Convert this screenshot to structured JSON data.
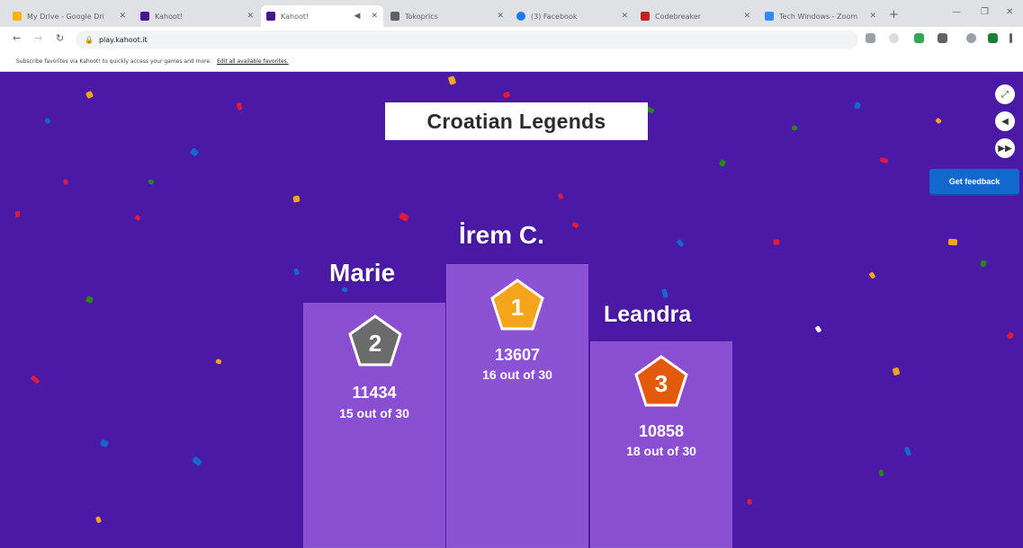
{
  "browser": {
    "tabs": [
      {
        "title": "My Drive - Google Dri",
        "color": "#f4b400",
        "active": false
      },
      {
        "title": "Kahoot!",
        "color": "#46178f",
        "active": false
      },
      {
        "title": "Kahoot!",
        "color": "#46178f",
        "active": true
      },
      {
        "title": "Tokoprics",
        "color": "#5f6368",
        "active": false
      },
      {
        "title": "(3) Facebook",
        "color": "#1877f2",
        "active": false
      },
      {
        "title": "Codebreaker",
        "color": "#c5221f",
        "active": false
      },
      {
        "title": "Tech Windows - Zoom",
        "color": "#2d8cff",
        "active": false
      }
    ],
    "url": "play.kahoot.it",
    "infobar_text": "Subscribe favorites via Kahoot! to quickly access your games and more.",
    "infobar_link": "Edit all available favorites."
  },
  "game": {
    "quiz_title": "Croatian Legends",
    "feedback_label": "Get feedback",
    "colors": {
      "background": "#4a1aa6",
      "podium": "#8a4fd0",
      "gold": "#f4a51c",
      "silver": "#6b6b6b",
      "bronze": "#e35a0a",
      "feedback_button": "#1368ce"
    },
    "players": [
      {
        "rank": "2",
        "name": "Marie",
        "score": "11434",
        "correct": "15 out of 30",
        "medal": "silver"
      },
      {
        "rank": "1",
        "name": "İrem C.",
        "score": "13607",
        "correct": "16 out of 30",
        "medal": "gold"
      },
      {
        "rank": "3",
        "name": "Leandra",
        "score": "10858",
        "correct": "18 out of 30",
        "medal": "bronze"
      }
    ]
  }
}
